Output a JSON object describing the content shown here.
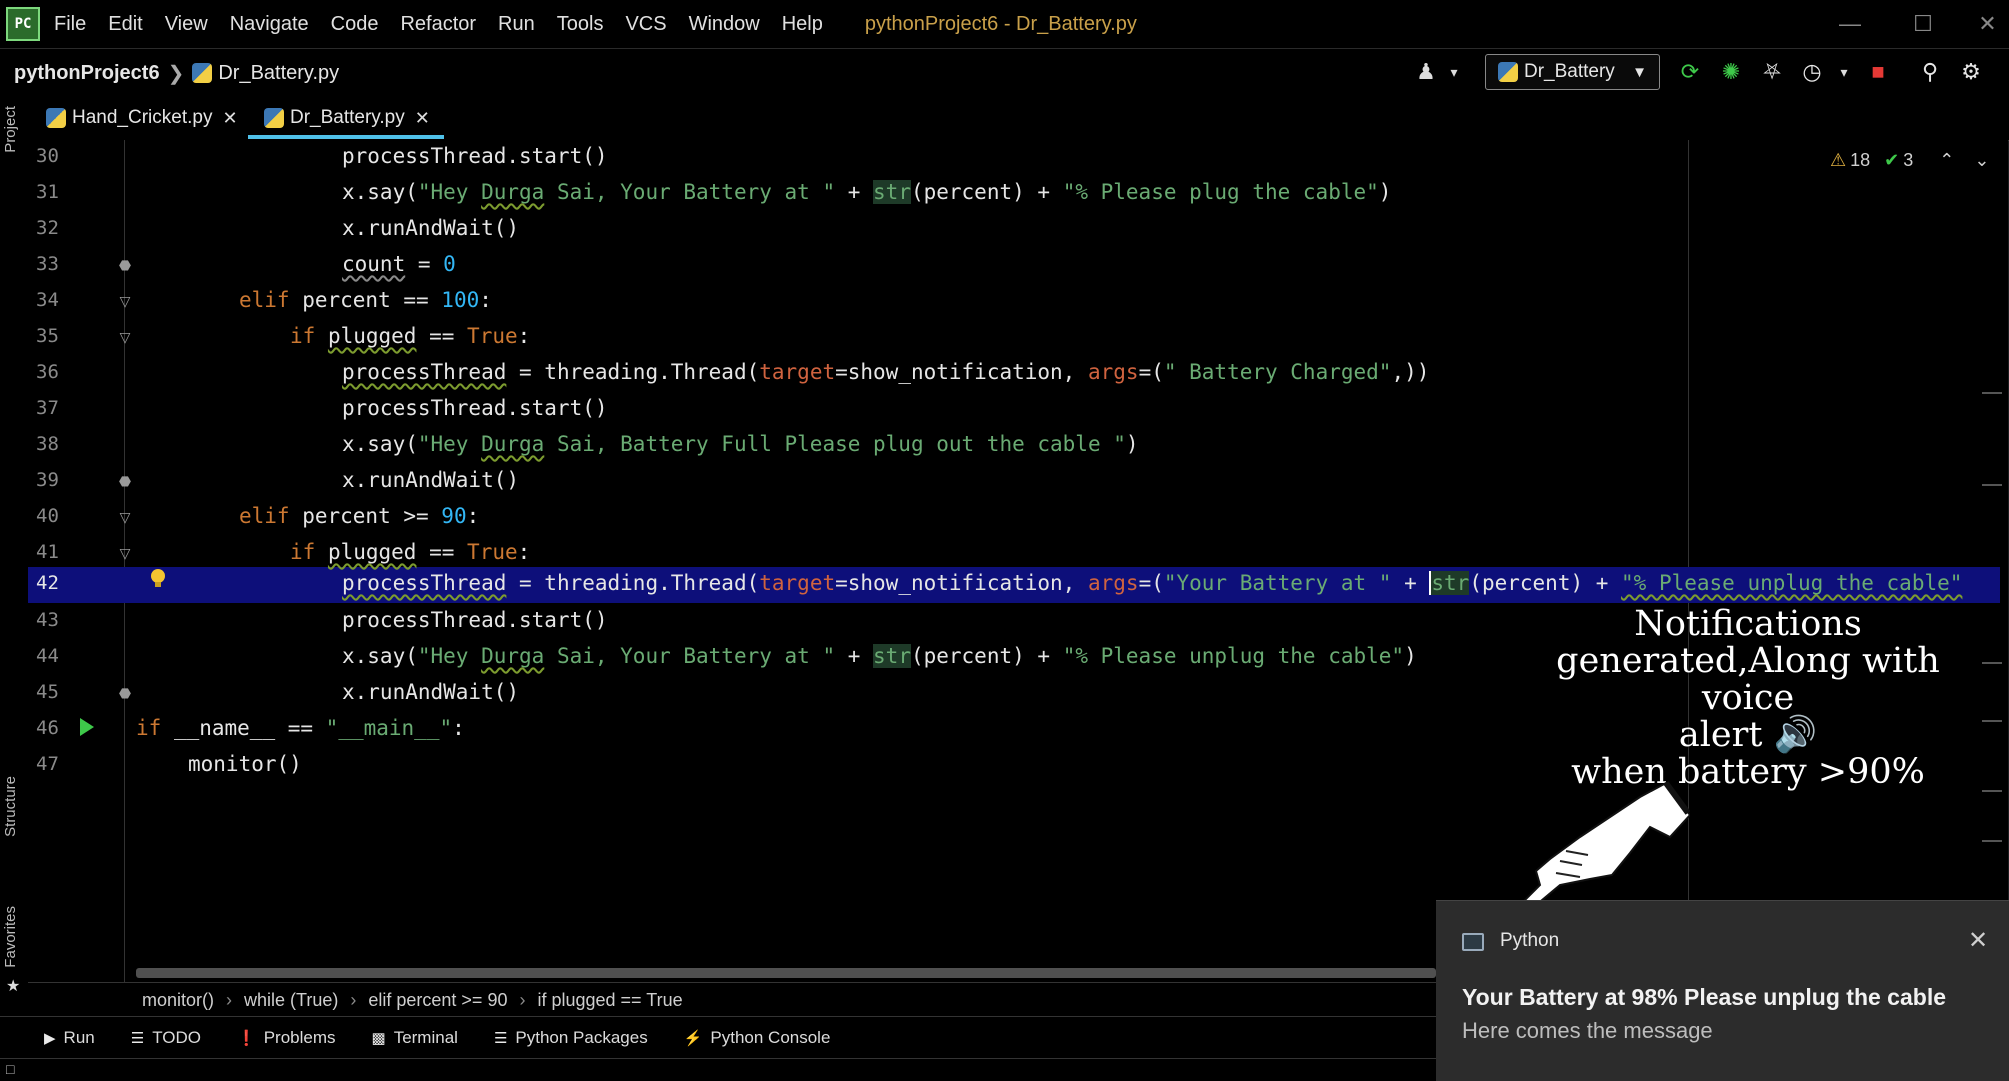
{
  "app": {
    "logo_text": "PC",
    "menu": [
      "File",
      "Edit",
      "View",
      "Navigate",
      "Code",
      "Refactor",
      "Run",
      "Tools",
      "VCS",
      "Window",
      "Help"
    ],
    "window_title": "pythonProject6 - Dr_Battery.py",
    "window_controls": [
      "minimize",
      "maximize",
      "close"
    ]
  },
  "navbar": {
    "project": "pythonProject6",
    "file": "Dr_Battery.py",
    "run_config": "Dr_Battery"
  },
  "left_strip": {
    "project_label": "Project",
    "structure_label": "Structure",
    "favorites_label": "Favorites"
  },
  "tabs": [
    {
      "label": "Hand_Cricket.py",
      "active": false
    },
    {
      "label": "Dr_Battery.py",
      "active": true
    }
  ],
  "inspections": {
    "warnings": "18",
    "weak_warnings": "3"
  },
  "code": {
    "line_numbers": [
      "30",
      "31",
      "32",
      "33",
      "34",
      "35",
      "36",
      "37",
      "38",
      "39",
      "40",
      "41",
      "42",
      "43",
      "44",
      "45",
      "46",
      "47"
    ],
    "current_line": "42"
  },
  "code_breadcrumbs": [
    "monitor()",
    "while (True)",
    "elif percent >= 90",
    "if plugged == True"
  ],
  "tool_windows": [
    {
      "label": "Run",
      "icon": "play-icon"
    },
    {
      "label": "TODO",
      "icon": "list-icon"
    },
    {
      "label": "Problems",
      "icon": "info-icon"
    },
    {
      "label": "Terminal",
      "icon": "terminal-icon"
    },
    {
      "label": "Python Packages",
      "icon": "layers-icon"
    },
    {
      "label": "Python Console",
      "icon": "python-icon"
    }
  ],
  "annotation": {
    "line1": "Notifications",
    "line2": "generated,Along with voice",
    "line3": "alert 🔊",
    "line4": "when battery >90%"
  },
  "toast": {
    "app": "Python",
    "title": "Your Battery at 98% Please unplug the cable",
    "message": "Here comes the message"
  },
  "colors": {
    "keyword": "#cc7832",
    "string": "#6aab73",
    "number": "#33b7f5",
    "param": "#d0633f",
    "highlight_row": "#0d0f7a",
    "title_text": "#c9a04a"
  }
}
